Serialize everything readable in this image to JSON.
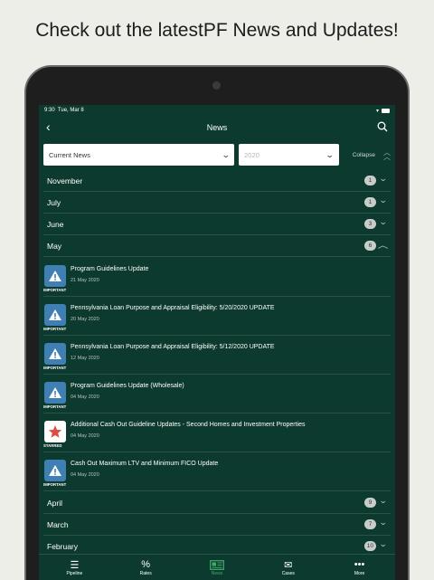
{
  "headline": "Check out the latestPF News and Updates!",
  "status_bar": {
    "time": "9:30",
    "date": "Tue, Mar 8"
  },
  "nav": {
    "title": "News"
  },
  "filters": {
    "news_type": "Current News",
    "year": "2020",
    "collapse_label": "Collapse"
  },
  "months": [
    {
      "label": "November",
      "count": "1"
    },
    {
      "label": "July",
      "count": "1"
    },
    {
      "label": "June",
      "count": "3"
    },
    {
      "label": "May",
      "count": "6"
    },
    {
      "label": "April",
      "count": "9"
    },
    {
      "label": "March",
      "count": "7"
    },
    {
      "label": "February",
      "count": "10"
    }
  ],
  "may_items": [
    {
      "title": "Program Guidelines Update",
      "date": "21 May 2020",
      "tag": "IMPORTANT",
      "icon": "warning-icon"
    },
    {
      "title": "Pennsylvania Loan Purpose and Appraisal Eligibility: 5/20/2020 UPDATE",
      "date": "20 May 2020",
      "tag": "IMPORTANT",
      "icon": "warning-icon"
    },
    {
      "title": "Pennsylvania Loan Purpose and Appraisal Eligibility: 5/12/2020 UPDATE",
      "date": "12 May 2020",
      "tag": "IMPORTANT",
      "icon": "warning-icon"
    },
    {
      "title": "Program Guidelines Update (Wholesale)",
      "date": "04 May 2020",
      "tag": "IMPORTANT",
      "icon": "warning-icon"
    },
    {
      "title": "Additional Cash Out Guideline Updates - Second Homes and Investment Properties",
      "date": "04 May 2020",
      "tag": "STARRED",
      "icon": "star-icon"
    },
    {
      "title": "Cash Out Maximum LTV and Minimum FICO Update",
      "date": "04 May 2020",
      "tag": "IMPORTANT",
      "icon": "warning-icon"
    }
  ],
  "tabs": [
    {
      "label": "Pipeline",
      "icon": "list-icon"
    },
    {
      "label": "Rates",
      "icon": "percent-icon"
    },
    {
      "label": "News",
      "icon": "newspaper-icon"
    },
    {
      "label": "Cases",
      "icon": "envelope-icon"
    },
    {
      "label": "More",
      "icon": "more-icon"
    }
  ],
  "colors": {
    "background": "#0d3a2e",
    "accent": "#3fae6b",
    "important": "#3f7fb4",
    "starred": "#e04b44"
  }
}
